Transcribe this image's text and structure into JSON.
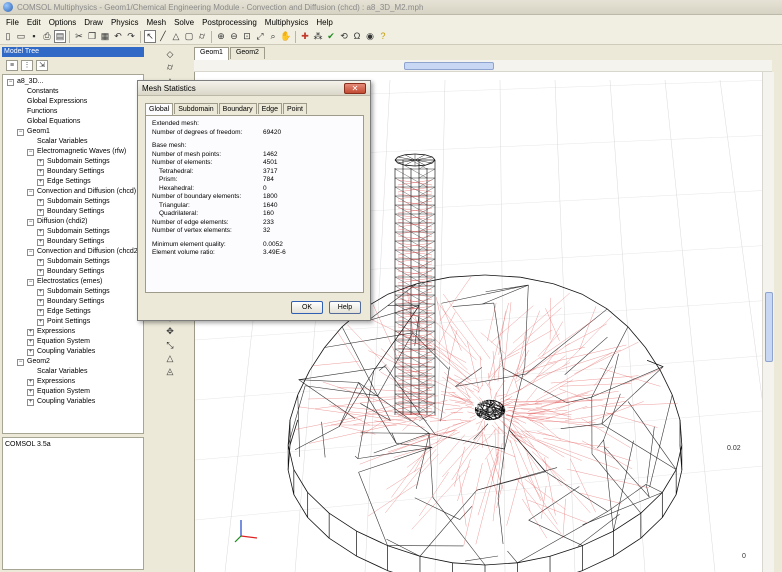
{
  "window": {
    "title": "COMSOL Multiphysics - Geom1/Chemical Engineering Module - Convection and Diffusion (chcd) : a8_3D_M2.mph"
  },
  "menubar": [
    "File",
    "Edit",
    "Options",
    "Draw",
    "Physics",
    "Mesh",
    "Solve",
    "Postprocessing",
    "Multiphysics",
    "Help"
  ],
  "toolbar_icons": [
    "new-file-icon",
    "open-icon",
    "save-icon",
    "print-icon",
    "properties-icon",
    "cut-icon",
    "copy-icon",
    "paste-icon",
    "undo-icon",
    "redo-icon",
    "select-icon",
    "draw-line-icon",
    "draw-triangle-icon",
    "draw-box-icon",
    "draw-cylinder-icon",
    "zoom-in-icon",
    "zoom-out-icon",
    "zoom-window-icon",
    "zoom-extents-icon",
    "zoom-selected-icon",
    "pan-icon",
    "mesh-icon",
    "refine-mesh-icon",
    "solve-icon",
    "restart-icon",
    "ohm-icon",
    "plot-icon",
    "help-icon"
  ],
  "model_tree": {
    "header": "Model Tree",
    "items": [
      {
        "label": "a8_3D...",
        "level": 0,
        "exp": "-"
      },
      {
        "label": "Constants",
        "level": 1
      },
      {
        "label": "Global Expressions",
        "level": 1
      },
      {
        "label": "Functions",
        "level": 1
      },
      {
        "label": "Global Equations",
        "level": 1
      },
      {
        "label": "Geom1",
        "level": 1,
        "exp": "-"
      },
      {
        "label": "Scalar Variables",
        "level": 2
      },
      {
        "label": "Electromagnetic Waves (rfw)",
        "level": 2,
        "exp": "-"
      },
      {
        "label": "Subdomain Settings",
        "level": 3,
        "exp": "+"
      },
      {
        "label": "Boundary Settings",
        "level": 3,
        "exp": "+"
      },
      {
        "label": "Edge Settings",
        "level": 3,
        "exp": "+"
      },
      {
        "label": "Convection and Diffusion (chcd)",
        "level": 2,
        "exp": "-"
      },
      {
        "label": "Subdomain Settings",
        "level": 3,
        "exp": "+"
      },
      {
        "label": "Boundary Settings",
        "level": 3,
        "exp": "+"
      },
      {
        "label": "Diffusion (chdi2)",
        "level": 2,
        "exp": "-"
      },
      {
        "label": "Subdomain Settings",
        "level": 3,
        "exp": "+"
      },
      {
        "label": "Boundary Settings",
        "level": 3,
        "exp": "+"
      },
      {
        "label": "Convection and Diffusion (chcd2)",
        "level": 2,
        "exp": "-"
      },
      {
        "label": "Subdomain Settings",
        "level": 3,
        "exp": "+"
      },
      {
        "label": "Boundary Settings",
        "level": 3,
        "exp": "+"
      },
      {
        "label": "Electrostatics (emes)",
        "level": 2,
        "exp": "-"
      },
      {
        "label": "Subdomain Settings",
        "level": 3,
        "exp": "+"
      },
      {
        "label": "Boundary Settings",
        "level": 3,
        "exp": "+"
      },
      {
        "label": "Edge Settings",
        "level": 3,
        "exp": "+"
      },
      {
        "label": "Point Settings",
        "level": 3,
        "exp": "+"
      },
      {
        "label": "Expressions",
        "level": 2,
        "exp": "+"
      },
      {
        "label": "Equation System",
        "level": 2,
        "exp": "+"
      },
      {
        "label": "Coupling Variables",
        "level": 2,
        "exp": "+"
      },
      {
        "label": "Geom2",
        "level": 1,
        "exp": "-"
      },
      {
        "label": "Scalar Variables",
        "level": 2
      },
      {
        "label": "Expressions",
        "level": 2,
        "exp": "+"
      },
      {
        "label": "Equation System",
        "level": 2,
        "exp": "+"
      },
      {
        "label": "Coupling Variables",
        "level": 2,
        "exp": "+"
      }
    ]
  },
  "status_panel": {
    "text": "COMSOL 3.5a"
  },
  "geom_tabs": [
    "Geom1",
    "Geom2"
  ],
  "axis_ticks": {
    "upper": "0.02",
    "lower": "0"
  },
  "dialog": {
    "title": "Mesh Statistics",
    "tabs": [
      "Global",
      "Subdomain",
      "Boundary",
      "Edge",
      "Point"
    ],
    "rows": [
      {
        "label": "Extended mesh:",
        "value": "",
        "indent": 0
      },
      {
        "label": "Number of degrees of freedom:",
        "value": "69420",
        "indent": 0
      },
      {
        "gap": true
      },
      {
        "label": "Base mesh:",
        "value": "",
        "indent": 0
      },
      {
        "label": "Number of mesh points:",
        "value": "1462",
        "indent": 0
      },
      {
        "label": "Number of elements:",
        "value": "4501",
        "indent": 0
      },
      {
        "label": "Tetrahedral:",
        "value": "3717",
        "indent": 1
      },
      {
        "label": "Prism:",
        "value": "784",
        "indent": 1
      },
      {
        "label": "Hexahedral:",
        "value": "0",
        "indent": 1
      },
      {
        "label": "Number of boundary elements:",
        "value": "1800",
        "indent": 0
      },
      {
        "label": "Triangular:",
        "value": "1640",
        "indent": 1
      },
      {
        "label": "Quadrilateral:",
        "value": "160",
        "indent": 1
      },
      {
        "label": "Number of edge elements:",
        "value": "233",
        "indent": 0
      },
      {
        "label": "Number of vertex elements:",
        "value": "32",
        "indent": 0
      },
      {
        "gap": true
      },
      {
        "label": "Minimum element quality:",
        "value": "0.0052",
        "indent": 0
      },
      {
        "label": "Element volume ratio:",
        "value": "3.49E-6",
        "indent": 0
      }
    ],
    "ok_label": "OK",
    "help_label": "Help"
  }
}
